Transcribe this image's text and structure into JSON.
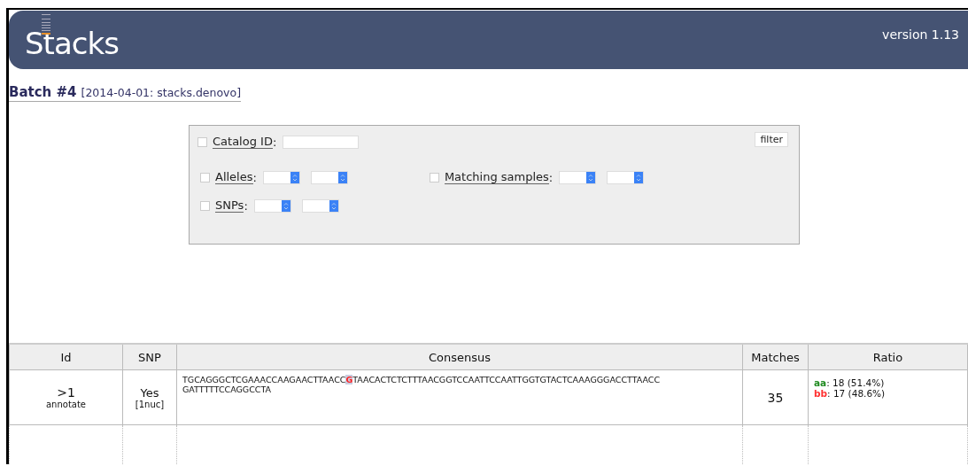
{
  "header": {
    "logo": "Stacks",
    "version": "version 1.13"
  },
  "batch": {
    "title": "Batch #4",
    "detail": "[2014-04-01: stacks.denovo]"
  },
  "filters": {
    "button": "filter",
    "rows": [
      [
        {
          "label": "Catalog ID",
          "suffix": ":",
          "kind": "text",
          "checked": false
        }
      ],
      [
        {
          "label": "Alleles",
          "suffix": ":",
          "kind": "range",
          "checked": false
        },
        {
          "label": "Matching samples",
          "suffix": ":",
          "kind": "range",
          "checked": false
        }
      ],
      [
        {
          "label": "SNPs",
          "suffix": ":",
          "kind": "range",
          "checked": false
        }
      ]
    ]
  },
  "table": {
    "columns": [
      "Id",
      "SNP",
      "Consensus",
      "Matches",
      "Ratio"
    ],
    "rows": [
      {
        "id": ">1",
        "link": "annotate",
        "snp": "Yes",
        "snp_detail": "[1nuc]",
        "consensus": [
          [
            {
              "text": "TGCAGGGCTCGAAACCAAGAACTTAACC",
              "snp": false
            },
            {
              "text": "G",
              "snp": true
            },
            {
              "text": "TAACACTCTCTTTAACGGTCCAATTCCAATTGGTGTACTCAAAGGGACCTTAACC",
              "snp": false
            }
          ],
          [
            {
              "text": "GATTTTTCCAGGCCTA",
              "snp": false
            }
          ]
        ],
        "matches": "35",
        "ratio": [
          {
            "allele": "aa",
            "count": ": 18 (51.4%)",
            "color": "#228b22"
          },
          {
            "allele": "bb",
            "count": ": 17 (48.6%)",
            "color": "#ff3333"
          }
        ]
      }
    ]
  }
}
